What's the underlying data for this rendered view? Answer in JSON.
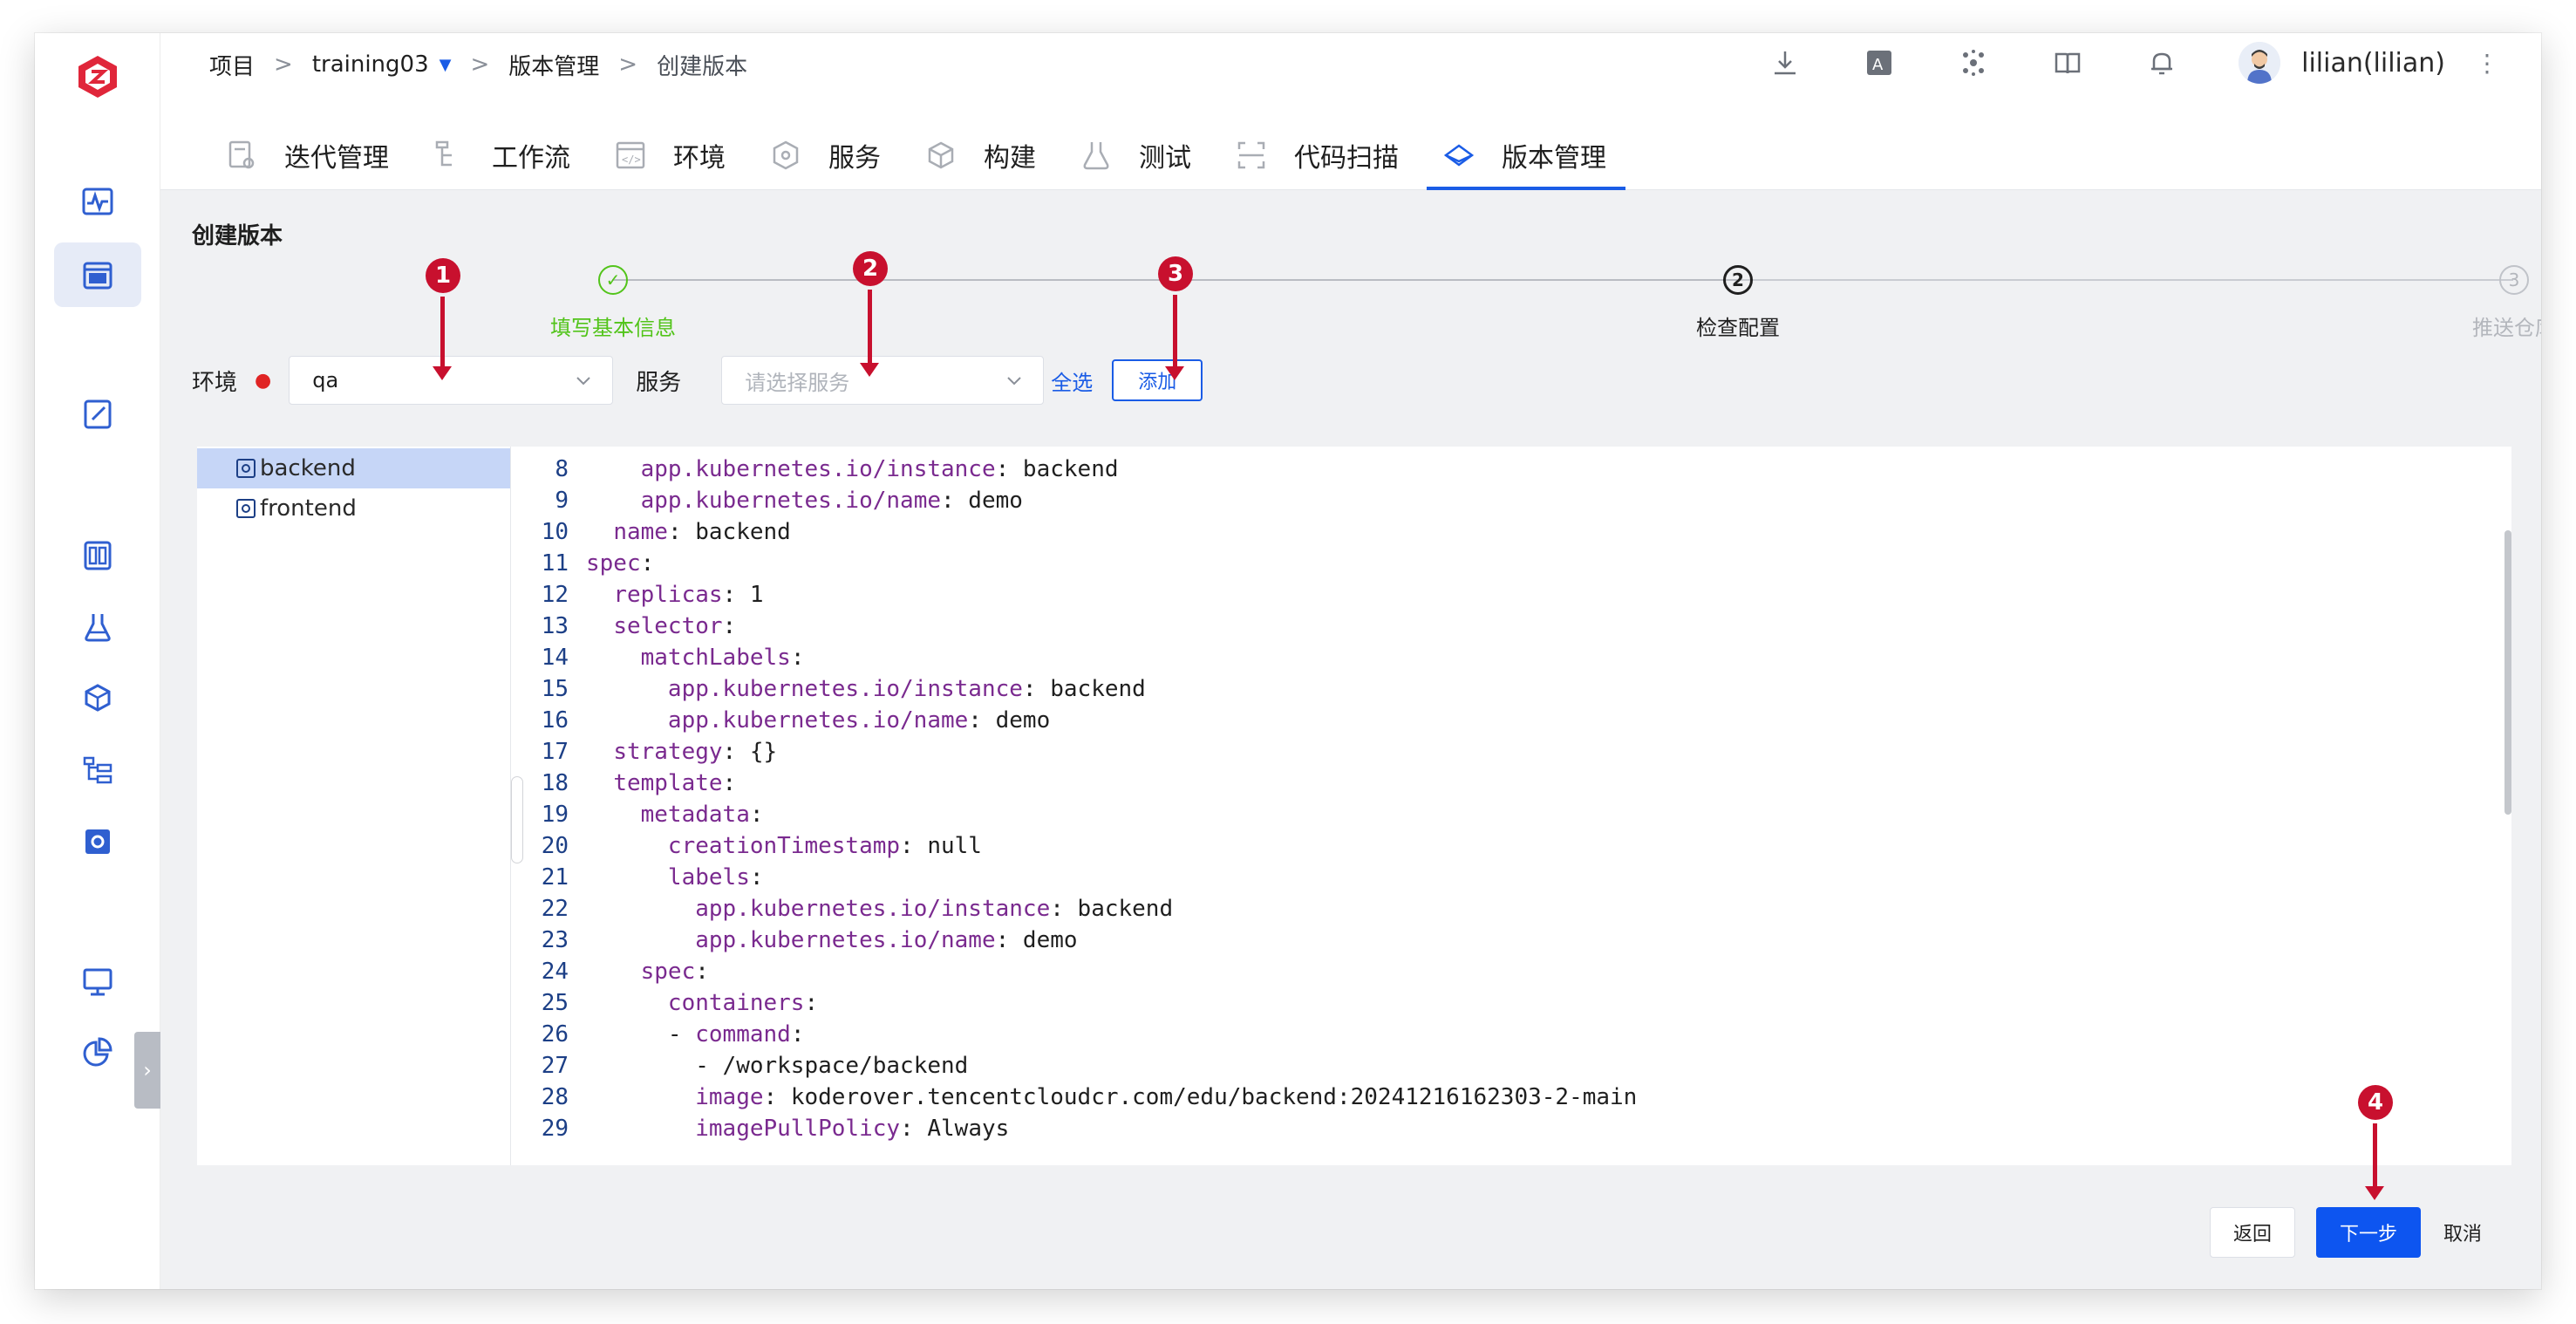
{
  "breadcrumb": {
    "root": "项目",
    "project": "training03",
    "section": "版本管理",
    "current": "创建版本",
    "sep": ">"
  },
  "header": {
    "username": "lilian(lilian)",
    "icons": [
      "download-icon",
      "translate-icon",
      "cluster-icon",
      "docs-icon",
      "bell-icon"
    ]
  },
  "tabs": [
    {
      "label": "迭代管理",
      "icon": "iteration-icon"
    },
    {
      "label": "工作流",
      "icon": "workflow-icon"
    },
    {
      "label": "环境",
      "icon": "environment-icon"
    },
    {
      "label": "服务",
      "icon": "service-icon"
    },
    {
      "label": "构建",
      "icon": "build-icon"
    },
    {
      "label": "测试",
      "icon": "test-icon"
    },
    {
      "label": "代码扫描",
      "icon": "scan-icon"
    },
    {
      "label": "版本管理",
      "icon": "release-icon",
      "active": true
    }
  ],
  "page": {
    "title": "创建版本"
  },
  "steps": [
    {
      "label": "填写基本信息",
      "status": "done",
      "marker": "✓"
    },
    {
      "label": "检查配置",
      "status": "current",
      "marker": "2"
    },
    {
      "label": "推送仓库",
      "status": "pending",
      "marker": "3"
    }
  ],
  "form": {
    "env_label": "环境",
    "env_value": "qa",
    "service_label": "服务",
    "service_placeholder": "请选择服务",
    "select_all": "全选",
    "add_button": "添加"
  },
  "tree": [
    {
      "name": "backend",
      "selected": true
    },
    {
      "name": "frontend",
      "selected": false
    }
  ],
  "code": [
    {
      "n": "8",
      "indent": "    ",
      "key": "app.kubernetes.io/instance",
      "val": " backend"
    },
    {
      "n": "9",
      "indent": "    ",
      "key": "app.kubernetes.io/name",
      "val": " demo"
    },
    {
      "n": "10",
      "indent": "  ",
      "key": "name",
      "val": " backend"
    },
    {
      "n": "11",
      "indent": "",
      "key": "spec",
      "val": ""
    },
    {
      "n": "12",
      "indent": "  ",
      "key": "replicas",
      "val": " 1"
    },
    {
      "n": "13",
      "indent": "  ",
      "key": "selector",
      "val": ""
    },
    {
      "n": "14",
      "indent": "    ",
      "key": "matchLabels",
      "val": ""
    },
    {
      "n": "15",
      "indent": "      ",
      "key": "app.kubernetes.io/instance",
      "val": " backend"
    },
    {
      "n": "16",
      "indent": "      ",
      "key": "app.kubernetes.io/name",
      "val": " demo"
    },
    {
      "n": "17",
      "indent": "  ",
      "key": "strategy",
      "val": " {}"
    },
    {
      "n": "18",
      "indent": "  ",
      "key": "template",
      "val": ""
    },
    {
      "n": "19",
      "indent": "    ",
      "key": "metadata",
      "val": ""
    },
    {
      "n": "20",
      "indent": "      ",
      "key": "creationTimestamp",
      "val": " null"
    },
    {
      "n": "21",
      "indent": "      ",
      "key": "labels",
      "val": ""
    },
    {
      "n": "22",
      "indent": "        ",
      "key": "app.kubernetes.io/instance",
      "val": " backend"
    },
    {
      "n": "23",
      "indent": "        ",
      "key": "app.kubernetes.io/name",
      "val": " demo"
    },
    {
      "n": "24",
      "indent": "    ",
      "key": "spec",
      "val": ""
    },
    {
      "n": "25",
      "indent": "      ",
      "key": "containers",
      "val": ""
    },
    {
      "n": "26",
      "indent": "      - ",
      "key": "command",
      "val": ""
    },
    {
      "n": "27",
      "indent": "        ",
      "key": "",
      "val": "- /workspace/backend"
    },
    {
      "n": "28",
      "indent": "        ",
      "key": "image",
      "val": " koderover.tencentcloudcr.com/edu/backend:20241216162303-2-main"
    },
    {
      "n": "29",
      "indent": "        ",
      "key": "imagePullPolicy",
      "val": " Always"
    }
  ],
  "footer": {
    "back": "返回",
    "next": "下一步",
    "cancel": "取消"
  },
  "annotations": [
    "1",
    "2",
    "3",
    "4"
  ],
  "colors": {
    "accent": "#1a5ce6",
    "primary_button": "#0d55f0",
    "step_done": "#52c41a",
    "annotation": "#c8102e"
  }
}
